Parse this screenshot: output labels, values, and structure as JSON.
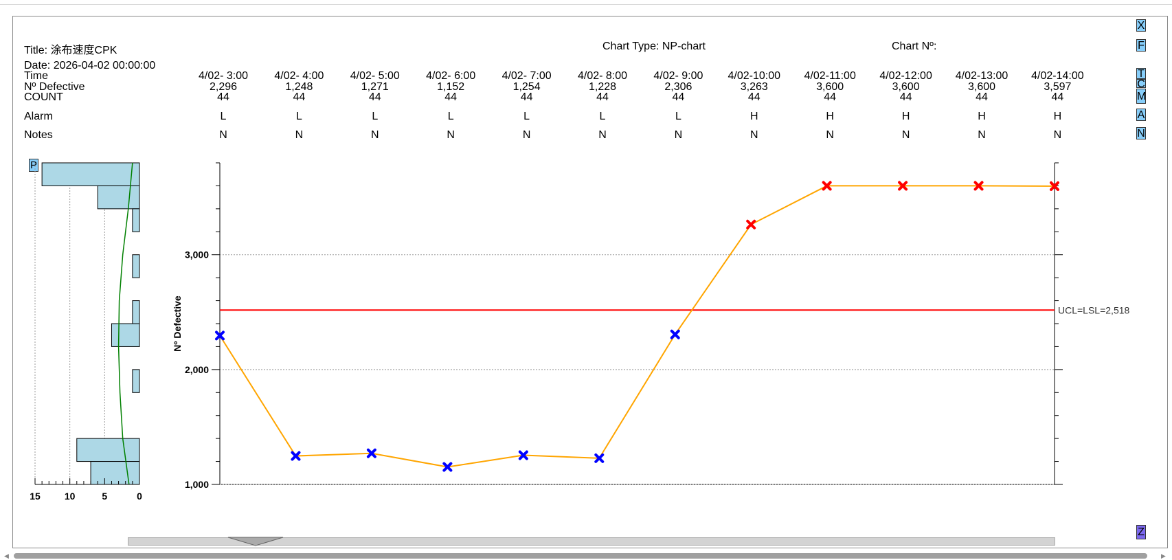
{
  "header": {
    "title_label": "Title: 涂布速度CPK",
    "chart_type_label": "Chart Type: NP-chart",
    "chart_no_label": "Chart Nº:",
    "date_label": "Date: 2026-04-02 00:00:00"
  },
  "row_labels": {
    "time": "Time",
    "defective": "Nº Defective",
    "count": "COUNT",
    "alarm": "Alarm",
    "notes": "Notes"
  },
  "side_buttons": [
    "X",
    "F",
    "T",
    "C",
    "M",
    "A",
    "N"
  ],
  "p_button": "P",
  "z_button": "Z",
  "colors": {
    "line": "#ffa500",
    "in_control": "#0000ff",
    "out_of_control": "#ff0000",
    "limit": "#ff0000",
    "histogram": "#add8e6",
    "curve": "#008000"
  },
  "chart_data": {
    "type": "line",
    "x": [
      "4/02- 3:00",
      "4/02- 4:00",
      "4/02- 5:00",
      "4/02- 6:00",
      "4/02- 7:00",
      "4/02- 8:00",
      "4/02- 9:00",
      "4/02-10:00",
      "4/02-11:00",
      "4/02-12:00",
      "4/02-13:00",
      "4/02-14:00"
    ],
    "defective_labels": [
      "2,296",
      "1,248",
      "1,271",
      "1,152",
      "1,254",
      "1,228",
      "2,306",
      "3,263",
      "3,600",
      "3,600",
      "3,600",
      "3,597"
    ],
    "values": [
      2296,
      1248,
      1271,
      1152,
      1254,
      1228,
      2306,
      3263,
      3600,
      3600,
      3600,
      3597
    ],
    "count": [
      "44",
      "44",
      "44",
      "44",
      "44",
      "44",
      "44",
      "44",
      "44",
      "44",
      "44",
      "44"
    ],
    "alarm": [
      "L",
      "L",
      "L",
      "L",
      "L",
      "L",
      "L",
      "H",
      "H",
      "H",
      "H",
      "H"
    ],
    "notes": [
      "N",
      "N",
      "N",
      "N",
      "N",
      "N",
      "N",
      "N",
      "N",
      "N",
      "N",
      "N"
    ],
    "ylabel": "Nº Defective",
    "ylim": [
      1000,
      3800
    ],
    "y_ticks": [
      1000,
      2000,
      3000
    ],
    "y_tick_labels": [
      "1,000",
      "2,000",
      "3,000"
    ],
    "limit_value": 2518,
    "limit_label": "UCL=LSL=2,518",
    "histogram": {
      "xlim": [
        15,
        0
      ],
      "x_ticks": [
        15,
        10,
        5,
        0
      ],
      "x_tick_labels": [
        "15",
        "10",
        "5",
        "0"
      ],
      "bins": [
        {
          "from": 3600,
          "to": 3800,
          "count": 14
        },
        {
          "from": 3400,
          "to": 3600,
          "count": 6
        },
        {
          "from": 3200,
          "to": 3400,
          "count": 1
        },
        {
          "from": 3000,
          "to": 3200,
          "count": 0
        },
        {
          "from": 2800,
          "to": 3000,
          "count": 1
        },
        {
          "from": 2600,
          "to": 2800,
          "count": 0
        },
        {
          "from": 2400,
          "to": 2600,
          "count": 1
        },
        {
          "from": 2200,
          "to": 2400,
          "count": 4
        },
        {
          "from": 2000,
          "to": 2200,
          "count": 0
        },
        {
          "from": 1800,
          "to": 2000,
          "count": 1
        },
        {
          "from": 1600,
          "to": 1800,
          "count": 0
        },
        {
          "from": 1400,
          "to": 1600,
          "count": 0
        },
        {
          "from": 1200,
          "to": 1400,
          "count": 9
        },
        {
          "from": 1000,
          "to": 1200,
          "count": 7
        }
      ],
      "curve": [
        [
          1,
          3800
        ],
        [
          1.6,
          3400
        ],
        [
          2.4,
          3000
        ],
        [
          2.9,
          2600
        ],
        [
          3.0,
          2200
        ],
        [
          2.8,
          1800
        ],
        [
          2.4,
          1400
        ],
        [
          1.5,
          1000
        ]
      ]
    }
  }
}
